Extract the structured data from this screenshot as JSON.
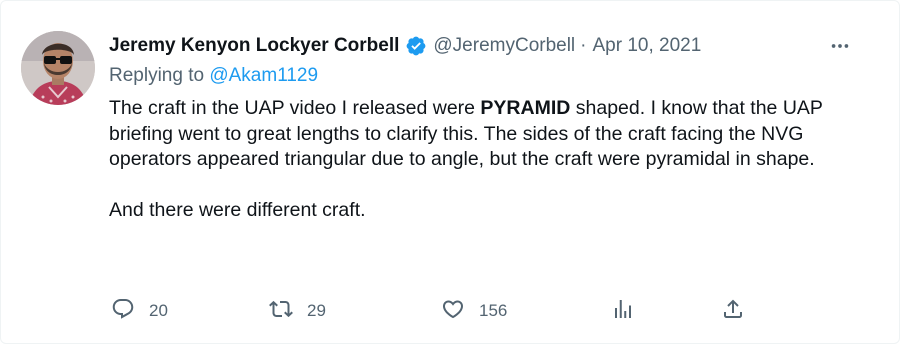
{
  "author": {
    "name": "Jeremy Kenyon Lockyer Corbell",
    "handle": "@JeremyCorbell",
    "separator": "·",
    "date": "Apr 10, 2021"
  },
  "reply": {
    "prefix": "Replying to ",
    "mention": "@Akam1129"
  },
  "body": {
    "p1_before": "The craft in the UAP video I released were ",
    "p1_bold": "PYRAMID",
    "p1_after": " shaped. I know that the UAP briefing went to great lengths to clarify this. The sides of the craft facing the NVG operators appeared triangular due to angle, but the craft were pyramidal in shape.",
    "p2": "And there were different craft."
  },
  "actions": {
    "replies": "20",
    "retweets": "29",
    "likes": "156"
  },
  "icons": {
    "verified": "verified-badge-icon",
    "more": "more-dots-icon",
    "reply": "reply-bubble-icon",
    "retweet": "retweet-icon",
    "like": "heart-icon",
    "views": "bar-chart-icon",
    "share": "share-upload-icon"
  },
  "colors": {
    "text": "#0f1419",
    "muted": "#536471",
    "accent": "#1d9bf0"
  }
}
